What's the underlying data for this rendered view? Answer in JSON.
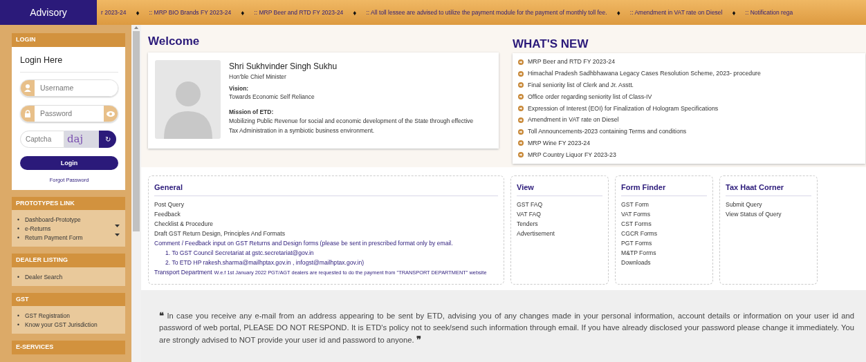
{
  "top_bar": {
    "label": "Advisory",
    "separator": "♦",
    "ticker": [
      "r 2023-24",
      ":: MRP BIO Brands FY 2023-24",
      ":: MRP Beer and RTD FY 2023-24",
      ":: All toll lessee are advised to utilize the payment module for the payment of monthly toll fee.",
      ":: Amendment in VAT rate on Diesel",
      ":: Notification rega"
    ]
  },
  "sidebar": {
    "login": {
      "header": "LOGIN",
      "title": "Login Here",
      "username_placeholder": "Username",
      "password_placeholder": "Password",
      "captcha_placeholder": "Captcha",
      "captcha_text": "daj",
      "refresh": "↻",
      "button": "Login",
      "forgot": "Forgot Password"
    },
    "sections": [
      {
        "header": "PROTOTYPES LINK",
        "items": [
          {
            "label": "Dashboard-Prototype",
            "has_submenu": false
          },
          {
            "label": "e-Returns",
            "has_submenu": true
          },
          {
            "label": "Return Payment Form",
            "has_submenu": true
          }
        ]
      },
      {
        "header": "DEALER LISTING",
        "items": [
          {
            "label": "Dealer Search",
            "has_submenu": false
          }
        ]
      },
      {
        "header": "GST",
        "items": [
          {
            "label": "GST Registration",
            "has_submenu": false
          },
          {
            "label": "Know your GST Jurisdiction",
            "has_submenu": false
          }
        ]
      },
      {
        "header": "E-SERVICES"
      }
    ],
    "marker": "•"
  },
  "welcome": {
    "title": "Welcome",
    "name": "Shri Sukhvinder Singh Sukhu",
    "role": "Hon'ble Chief Minister",
    "vision_label": "Vision:",
    "vision": "Towards Economic Self Reliance",
    "mission_label": "Mission of ETD:",
    "mission": "Mobilizing Public Revenue for social and economic development of the State through effective Tax Administration in a symbiotic business environment."
  },
  "whats_new": {
    "title": "WHAT'S NEW",
    "items": [
      "MRP Beer and RTD FY 2023-24",
      "Himachal Pradesh Sadhbhawana Legacy Cases Resolution Scheme, 2023- procedure",
      "Final seniority list of Clerk and Jr. Asstt.",
      "Office order regarding seniority list of Class-IV",
      "Expression of Interest (EOI) for Finalization of Hologram Specifications",
      "Amendment in VAT rate on Diesel",
      "Toll Announcements-2023 containing Terms and conditions",
      "MRP Wine FY 2023-24",
      "MRP Country Liquor FY 2023-23"
    ]
  },
  "link_boxes": [
    {
      "title": "General",
      "links": [
        {
          "kind": "link",
          "text": "Post Query"
        },
        {
          "kind": "link",
          "text": "Feedback"
        },
        {
          "kind": "link",
          "text": "Checklist & Procedure"
        },
        {
          "kind": "link",
          "text": "Draft GST Return Design, Principles And Formats"
        },
        {
          "kind": "text",
          "text": "Comment / Feedback input on GST Returns and Design forms (please be sent in prescribed format only by email."
        },
        {
          "kind": "indent",
          "text": "1. To GST Council Secretariat at gstc.secretariat@gov.in"
        },
        {
          "kind": "indent",
          "text": "2. To ETD HP rakesh.sharma@mailhptax.gov.in , infogst@mailhptax.gov.in)"
        },
        {
          "kind": "note",
          "text": "Transport Department",
          "note": "W.e.f 1st January 2022 PGT/AGT dealers are requested to do the payment from \"TRANSPORT DEPARTMENT\" website"
        }
      ]
    },
    {
      "title": "View",
      "links": [
        {
          "kind": "link",
          "text": "GST FAQ"
        },
        {
          "kind": "link",
          "text": "VAT FAQ"
        },
        {
          "kind": "link",
          "text": "Tenders"
        },
        {
          "kind": "link",
          "text": "Advertisement"
        }
      ]
    },
    {
      "title": "Form Finder",
      "links": [
        {
          "kind": "link",
          "text": "GST Form"
        },
        {
          "kind": "link",
          "text": "VAT Forms"
        },
        {
          "kind": "link",
          "text": "CST Forms"
        },
        {
          "kind": "link",
          "text": "CGCR Forms"
        },
        {
          "kind": "link",
          "text": "PGT Forms"
        },
        {
          "kind": "link",
          "text": "M&TP Forms"
        },
        {
          "kind": "link",
          "text": "Downloads"
        }
      ]
    },
    {
      "title": "Tax Haat Corner",
      "links": [
        {
          "kind": "link",
          "text": "Submit Query"
        },
        {
          "kind": "link",
          "text": "View Status of Query"
        }
      ]
    }
  ],
  "notice": {
    "open_quote": "❝",
    "text": "In case you receive any e-mail from an address appearing to be sent by ETD, advising you of any changes made in your personal information, account details or information on your user id and password of web portal, PLEASE DO NOT RESPOND. It is ETD's policy not to seek/send such information through email. If you have already disclosed your password please change it immediately. You are strongly advised to NOT provide your user id and password to anyone.",
    "close_quote": "❞"
  }
}
